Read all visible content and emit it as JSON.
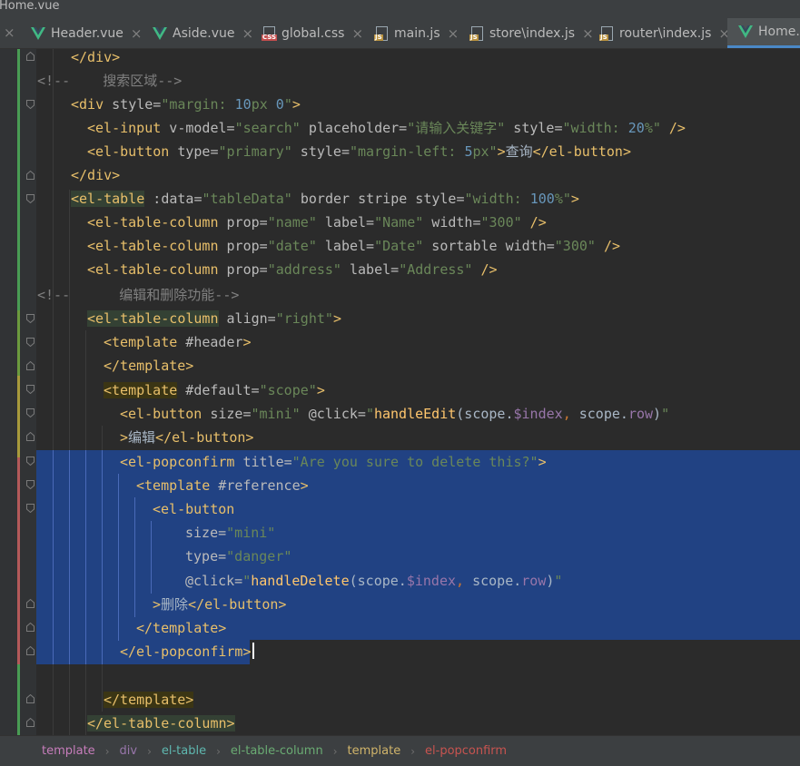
{
  "window": {
    "title": "Home.vue"
  },
  "tabs": [
    {
      "label": "Header.vue",
      "type": "vue",
      "active": false
    },
    {
      "label": "Aside.vue",
      "type": "vue",
      "active": false
    },
    {
      "label": "global.css",
      "type": "css",
      "active": false
    },
    {
      "label": "main.js",
      "type": "js",
      "active": false
    },
    {
      "label": "store\\index.js",
      "type": "js",
      "active": false
    },
    {
      "label": "router\\index.js",
      "type": "js",
      "active": false
    },
    {
      "label": "Home.v",
      "type": "vue",
      "active": true
    }
  ],
  "tab_close_glyph": "×",
  "file_badges": {
    "css": "CSS",
    "js": "JS"
  },
  "colors": {
    "accent": "#4a88c7",
    "selection": "#214283",
    "vcs_added": "#499c54",
    "vcs_modified": "#6c9a3e",
    "vcs_changed_yellow": "#a89a3c",
    "vcs_deleted_red": "#b45a5a"
  },
  "code": {
    "l1_tag": "</div>",
    "l2_comment": "<!--    搜索区域-->",
    "l3": {
      "open": "<div",
      "attr": " style=",
      "val_a": "\"margin: ",
      "num1": "10",
      "val_b": "px ",
      "num2": "0",
      "val_c": "\"",
      "close": ">"
    },
    "l4": {
      "open": "<el-input",
      "attr1": " v-model=",
      "val1": "\"search\"",
      "attr2": " placeholder=",
      "val2": "\"请输入关键字\"",
      "attr3": " style=",
      "val3a": "\"width: ",
      "num": "20",
      "val3b": "%\"",
      "close": " />"
    },
    "l5": {
      "open": "<el-button",
      "attr1": " type=",
      "val1": "\"primary\"",
      "attr2": " style=",
      "val2a": "\"margin-left: ",
      "num": "5",
      "val2b": "px\"",
      "gt": ">",
      "text": "查询",
      "end": "</el-button>"
    },
    "l6_tag": "</div>",
    "l7": {
      "open": "<el-table",
      "attr1": " :data=",
      "val1": "\"tableData\"",
      "attr2": " border stripe style=",
      "val2a": "\"width: ",
      "num": "100",
      "val2b": "%\"",
      "close": ">"
    },
    "l8": {
      "open": "<el-table-column",
      "attr1": " prop=",
      "val1": "\"name\"",
      "attr2": " label=",
      "val2": "\"Name\"",
      "attr3": " width=",
      "val3": "\"300\"",
      "close": " />"
    },
    "l9": {
      "open": "<el-table-column",
      "attr1": " prop=",
      "val1": "\"date\"",
      "attr2": " label=",
      "val2": "\"Date\"",
      "attr3": " sortable width=",
      "val3": "\"300\"",
      "close": " />"
    },
    "l10": {
      "open": "<el-table-column",
      "attr1": " prop=",
      "val1": "\"address\"",
      "attr2": " label=",
      "val2": "\"Address\"",
      "close": " />"
    },
    "l11_comment": "<!--      编辑和删除功能-->",
    "l12": {
      "open": "<el-table-column",
      "attr": " align=",
      "val": "\"right\"",
      "close": ">"
    },
    "l13": {
      "open": "<template",
      "attr": " #header",
      "close": ">"
    },
    "l14_tag": "</template>",
    "l15": {
      "open": "<template",
      "attr": " #default=",
      "val": "\"scope\"",
      "close": ">"
    },
    "l16": {
      "open": "<el-button",
      "attr1": " size=",
      "val1": "\"mini\"",
      "attr2": " @click=",
      "q1": "\"",
      "fn": "handleEdit",
      "args_a": "(scope.",
      "p1": "$index",
      "comma": ",",
      "args_b": " scope.",
      "p2": "row",
      "args_c": ")",
      "q2": "\""
    },
    "l17": {
      "gt": ">",
      "text": "编辑",
      "end": "</el-button>"
    },
    "l18": {
      "open": "<el-popconfirm",
      "attr": " title=",
      "val": "\"Are you sure to delete this?\"",
      "close": ">"
    },
    "l19": {
      "open": "<template",
      "attr": " #reference",
      "close": ">"
    },
    "l20_tag": "<el-button",
    "l21": {
      "attr": "size=",
      "val": "\"mini\""
    },
    "l22": {
      "attr": "type=",
      "val": "\"danger\""
    },
    "l23": {
      "attr": "@click=",
      "q1": "\"",
      "fn": "handleDelete",
      "args_a": "(scope.",
      "p1": "$index",
      "comma": ",",
      "args_b": " scope.",
      "p2": "row",
      "args_c": ")",
      "q2": "\""
    },
    "l24": {
      "gt": ">",
      "text": "删除",
      "end": "</el-button>"
    },
    "l25_tag": "</template>",
    "l26_tag": "</el-popconfirm>",
    "l28_tag": "</template>",
    "l29_tag": "</el-table-column>"
  },
  "breadcrumb": [
    {
      "label": "template",
      "color": "#c77dbb"
    },
    {
      "label": "div",
      "color": "#9876aa"
    },
    {
      "label": "el-table",
      "color": "#5fb8b0"
    },
    {
      "label": "el-table-column",
      "color": "#6aab73"
    },
    {
      "label": "template",
      "color": "#d0b46a"
    },
    {
      "label": "el-popconfirm",
      "color": "#c75450"
    }
  ],
  "breadcrumb_separator": "›"
}
